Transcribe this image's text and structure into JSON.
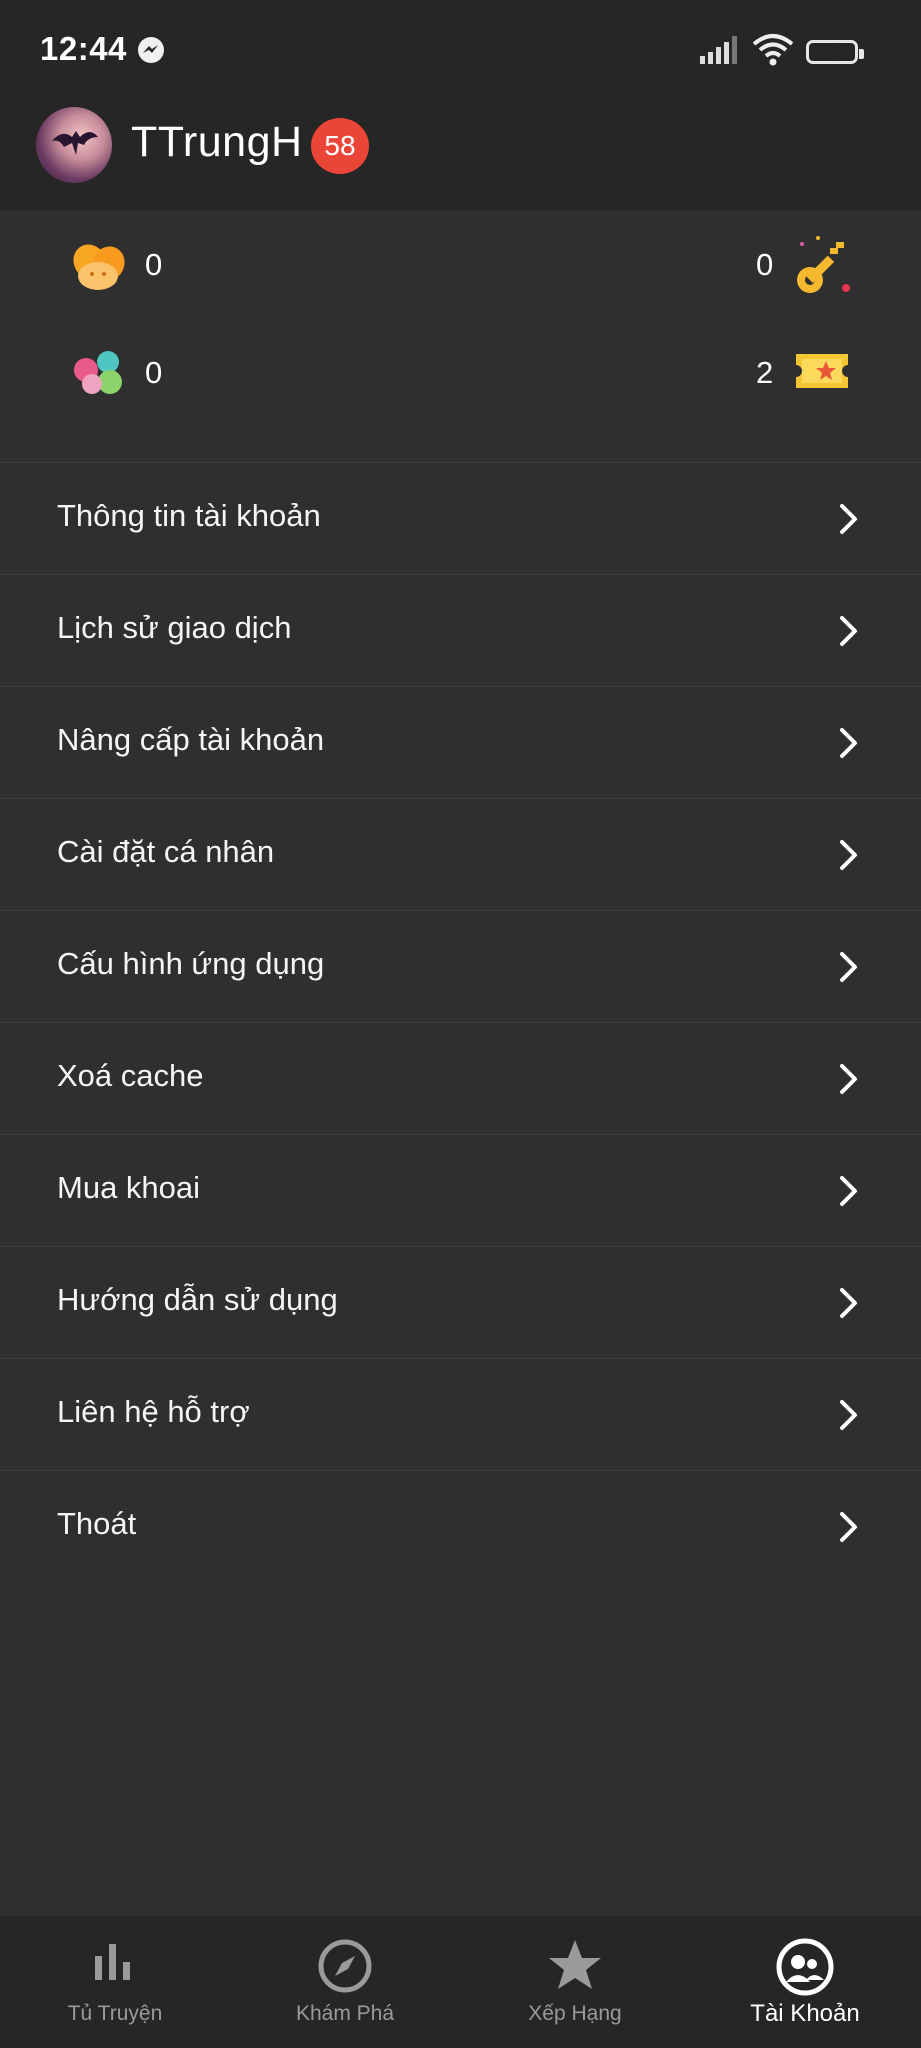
{
  "status_bar": {
    "time": "12:44",
    "battery": "79",
    "battery_fraction": 0.79,
    "icons": [
      "messenger-icon",
      "signal-icon",
      "wifi-icon",
      "battery-icon"
    ]
  },
  "profile": {
    "username": "TTrungH",
    "badge_count": "58"
  },
  "stats": {
    "potato_coins": "0",
    "keys": "0",
    "gems": "0",
    "tickets": "2"
  },
  "menu": {
    "items": [
      {
        "label": "Thông tin tài khoản"
      },
      {
        "label": "Lịch sử giao dịch"
      },
      {
        "label": "Nâng cấp tài khoản"
      },
      {
        "label": "Cài đặt cá nhân"
      },
      {
        "label": "Cấu hình ứng dụng"
      },
      {
        "label": "Xoá cache"
      },
      {
        "label": "Mua khoai"
      },
      {
        "label": "Hướng dẫn sử dụng"
      },
      {
        "label": "Liên hệ hỗ trợ"
      },
      {
        "label": "Thoát"
      }
    ]
  },
  "bottom_nav": {
    "items": [
      {
        "label": "Tủ Truyện",
        "icon": "bar-chart-icon"
      },
      {
        "label": "Khám Phá",
        "icon": "compass-icon"
      },
      {
        "label": "Xếp Hạng",
        "icon": "star-icon"
      },
      {
        "label": "Tài Khoản",
        "icon": "account-icon",
        "active": true
      }
    ]
  },
  "colors": {
    "background": "#2f2f30",
    "header": "#262626",
    "badge": "#ea4638",
    "divider": "#3e3e40",
    "nav_inactive": "#9a9a9a",
    "nav_active": "#ffffff"
  }
}
